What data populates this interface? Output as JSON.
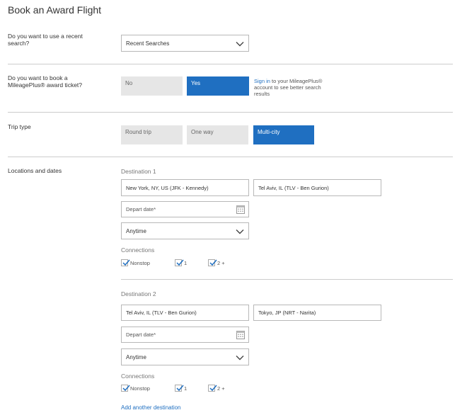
{
  "page": {
    "title": "Book an Award Flight"
  },
  "recent": {
    "question": "Do you want to use a recent search?",
    "select_value": "Recent Searches"
  },
  "award": {
    "question": "Do you want to book a MileagePlus® award ticket?",
    "no_label": "No",
    "yes_label": "Yes",
    "selected": "Yes",
    "signin_link": "Sign in",
    "signin_text": " to your MileagePlus® account to see better search results"
  },
  "trip": {
    "question": "Trip type",
    "options": [
      "Round trip",
      "One way",
      "Multi-city"
    ],
    "selected": "Multi-city"
  },
  "locations": {
    "label": "Locations and dates",
    "destinations": [
      {
        "heading": "Destination 1",
        "from": "New York, NY, US (JFK - Kennedy)",
        "to": "Tel Aviv, IL (TLV - Ben Gurion)",
        "depart_placeholder": "Depart date*",
        "time": "Anytime",
        "connections_label": "Connections",
        "connections": [
          {
            "label": "Nonstop",
            "checked": true
          },
          {
            "label": "1",
            "checked": true
          },
          {
            "label": "2 +",
            "checked": true
          }
        ]
      },
      {
        "heading": "Destination 2",
        "from": "Tel Aviv, IL (TLV - Ben Gurion)",
        "to": "Tokyo, JP (NRT - Narita)",
        "depart_placeholder": "Depart date*",
        "time": "Anytime",
        "connections_label": "Connections",
        "connections": [
          {
            "label": "Nonstop",
            "checked": true
          },
          {
            "label": "1",
            "checked": true
          },
          {
            "label": "2 +",
            "checked": true
          }
        ]
      }
    ],
    "add_link": "Add another destination"
  },
  "colors": {
    "accent": "#1f6fc1",
    "toggle_off": "#e6e6e6",
    "divider": "#cccccc"
  }
}
